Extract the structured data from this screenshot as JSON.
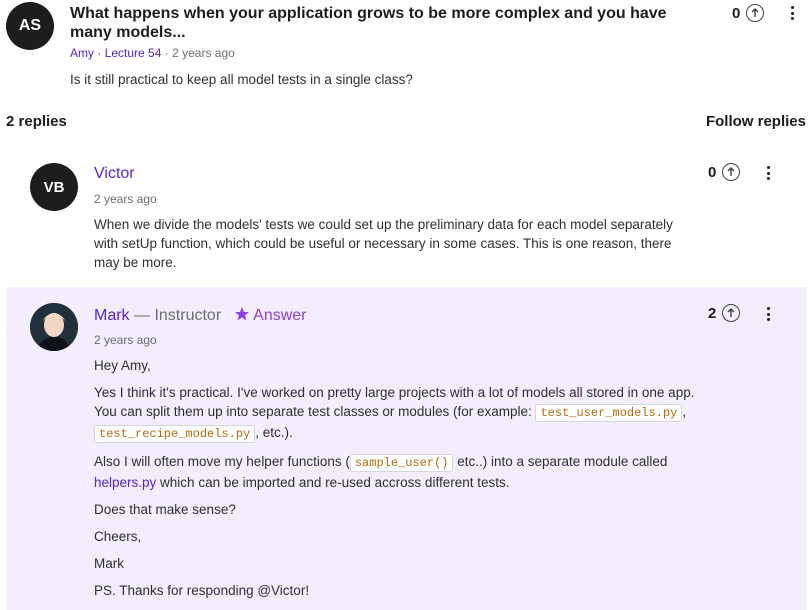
{
  "question": {
    "avatar_initials": "AS",
    "title": "What happens when your application grows to be more complex and you have many models...",
    "author": "Amy",
    "lecture": "Lecture 54",
    "time": "2 years ago",
    "body": "Is it still practical to keep all model tests in a single class?",
    "votes": "0"
  },
  "replies_header": {
    "count_label": "2 replies",
    "follow_label": "Follow replies"
  },
  "reply1": {
    "avatar_initials": "VB",
    "author": "Victor",
    "time": "2 years ago",
    "body": "When we divide the models' tests we could set up the preliminary data for each model separately with setUp function, which could be useful or necessary in some cases. This is one reason, there may be more.",
    "votes": "0"
  },
  "reply2": {
    "author": "Mark",
    "role": " — Instructor",
    "answer_label": "Answer",
    "time": "2 years ago",
    "votes": "2",
    "greeting": "Hey Amy,",
    "para1_a": "Yes I think it's practical. I've worked on pretty large projects with a lot of models all stored in one app. You can split them up into separate test classes or modules (for example: ",
    "code1": "test_user_models.py",
    "sep": ", ",
    "code2": "test_recipe_models.py",
    "para1_b": ", etc.).",
    "para2_a": "Also I will often move my helper functions (",
    "code3": "sample_user()",
    "para2_b": " etc..) into a separate module called ",
    "para2_link": "helpers.py",
    "para2_c": " which can be imported and re-used accross different tests.",
    "line3": "Does that make sense?",
    "line4": "Cheers,",
    "line5": "Mark",
    "line6": "PS. Thanks for responding @Victor!"
  },
  "colors": {
    "accent": "#5624d0",
    "instructor_bg": "#f3edfd",
    "code": "#b4690e"
  },
  "icons": [
    "upvote-icon",
    "more-vert-icon",
    "star-icon"
  ]
}
